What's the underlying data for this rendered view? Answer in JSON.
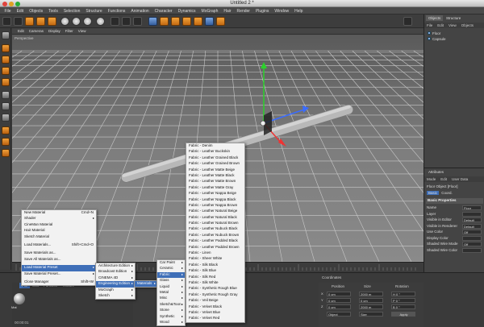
{
  "window": {
    "title": "Untitled 2 *"
  },
  "menubar": [
    "File",
    "Edit",
    "Objects",
    "Tools",
    "Selection",
    "Structure",
    "Functions",
    "Animation",
    "Character",
    "Dynamics",
    "MoGraph",
    "Hair",
    "Render",
    "Plugins",
    "Window",
    "Help"
  ],
  "viewport": {
    "menu": [
      "Edit",
      "Cameras",
      "Display",
      "Filter",
      "View"
    ],
    "label": "Perspective"
  },
  "objects_panel": {
    "tabs": [
      "Objects",
      "Structure"
    ],
    "menu": [
      "File",
      "Edit",
      "View",
      "Objects"
    ],
    "items": [
      "Floor",
      "Capsule"
    ]
  },
  "attributes_panel": {
    "title": "Attributes",
    "menu": [
      "Mode",
      "Edit",
      "User Data"
    ],
    "object_title": "Floor Object [Floor]",
    "tabs": [
      "Basic",
      "Coord."
    ],
    "section": "Basic Properties",
    "rows": [
      {
        "label": "Name",
        "value": "Floor"
      },
      {
        "label": "Layer",
        "value": ""
      },
      {
        "label": "Visible in Editor",
        "value": "Default"
      },
      {
        "label": "Visible in Renderer",
        "value": "Default"
      },
      {
        "label": "Use Color",
        "value": "Off"
      },
      {
        "label": "Display Color",
        "value": ""
      },
      {
        "label": "Shaded Wire Mode",
        "value": "Off"
      },
      {
        "label": "Shaded Wire Color",
        "value": ""
      }
    ]
  },
  "material_manager": {
    "menu": [
      "File",
      "Edit",
      "Function",
      "Texture"
    ],
    "material_name": "Mat",
    "status": "00:00:01"
  },
  "coordinates": {
    "title": "Coordinates",
    "headers": [
      "Position",
      "Size",
      "Rotation"
    ],
    "rows": [
      {
        "axis": "X",
        "pos": "0 cm",
        "size": "2000 m",
        "rot": "H 0 °"
      },
      {
        "axis": "Y",
        "pos": "0 cm",
        "size": "0 cm",
        "rot": "P 0 °"
      },
      {
        "axis": "Z",
        "pos": "0 cm",
        "size": "2000 m",
        "rot": "B 0 °"
      }
    ],
    "mode": "Object",
    "mode2": "Size",
    "apply": "Apply"
  },
  "file_menu": [
    {
      "label": "New Material",
      "shortcut": "Cmd+N"
    },
    {
      "label": "Shader",
      "arrow": true
    },
    {
      "label": "CineMan Material"
    },
    {
      "label": "Hair Material"
    },
    {
      "label": "Sketch Material"
    },
    {
      "sep": true
    },
    {
      "label": "Load Materials...",
      "shortcut": "Shift+Cmd+O"
    },
    {
      "sep": true
    },
    {
      "label": "Save Materials as..."
    },
    {
      "label": "Save All Materials as..."
    },
    {
      "sep": true
    },
    {
      "label": "Load Material Preset",
      "arrow": true,
      "hl": true
    },
    {
      "label": "Save Material Preset...",
      "arrow": true
    },
    {
      "sep": true
    },
    {
      "label": "Close Manager",
      "shortcut": "Shift+W"
    }
  ],
  "preset_menu": [
    {
      "label": "Architecture Edition",
      "arrow": true
    },
    {
      "label": "Broadcast Edition",
      "arrow": true
    },
    {
      "label": "CINEMA 4D",
      "arrow": true
    },
    {
      "label": "Engineering Edition",
      "arrow": true,
      "hl": true
    },
    {
      "label": "MoGraph",
      "arrow": true
    },
    {
      "label": "Sketch",
      "arrow": true
    }
  ],
  "eng_menu": [
    {
      "label": "Materials",
      "arrow": true,
      "hl": true
    }
  ],
  "category_menu": [
    {
      "label": "Car Paint",
      "arrow": true
    },
    {
      "label": "Ceramic",
      "arrow": true
    },
    {
      "label": "Fabric",
      "arrow": true,
      "hl": true
    },
    {
      "label": "Glass",
      "arrow": true
    },
    {
      "label": "Liquid",
      "arrow": true
    },
    {
      "label": "Metal",
      "arrow": true
    },
    {
      "label": "Misc",
      "arrow": true
    },
    {
      "label": "Sketch&Toon",
      "arrow": true
    },
    {
      "label": "Stone",
      "arrow": true
    },
    {
      "label": "Synthetic",
      "arrow": true
    },
    {
      "label": "Wood",
      "arrow": true
    }
  ],
  "fabric_menu": [
    "Fabric - Denim",
    "Fabric - Leather Buckskin",
    "Fabric - Leather Grained Black",
    "Fabric - Leather Grained Brown",
    "Fabric - Leather Matte Beige",
    "Fabric - Leather Matte Black",
    "Fabric - Leather Matte Brown",
    "Fabric - Leather Matte Gray",
    "Fabric - Leather Nappa Beige",
    "Fabric - Leather Nappa Black",
    "Fabric - Leather Nappa Brown",
    "Fabric - Leather Natural Beige",
    "Fabric - Leather Natural Black",
    "Fabric - Leather Natural Brown",
    "Fabric - Leather Nubuck Black",
    "Fabric - Leather Nubuck Brown",
    "Fabric - Leather Padded Black",
    "Fabric - Leather Padded Brown",
    "Fabric - Linen",
    "Fabric - Sheer White",
    "Fabric - Silk Black",
    "Fabric - Silk Blue",
    "Fabric - Silk Red",
    "Fabric - Silk White",
    "Fabric - Synthetic Rough Blue",
    "Fabric - Synthetic Rough Gray",
    "Fabric - Veil Beige",
    "Fabric - Velvet Black",
    "Fabric - Velvet Blue",
    "Fabric - Velvet Red"
  ]
}
